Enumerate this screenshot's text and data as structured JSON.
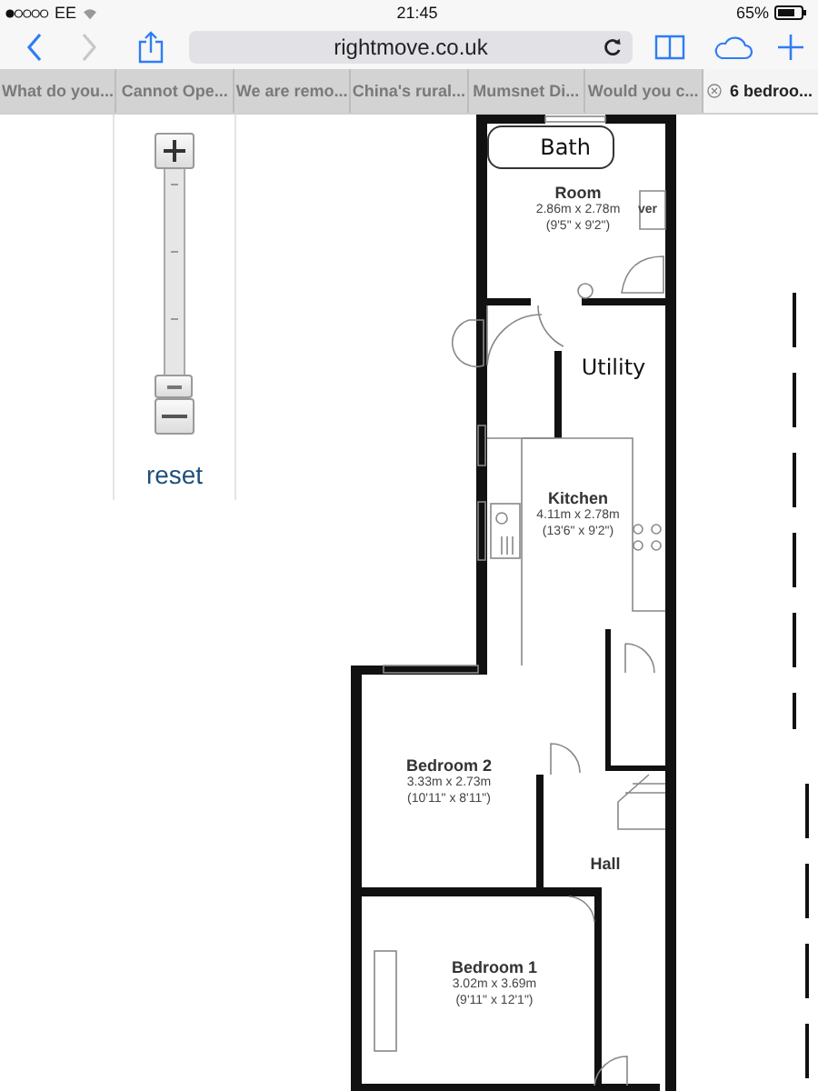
{
  "status_bar": {
    "carrier": "EE",
    "time": "21:45",
    "battery": "65%"
  },
  "toolbar": {
    "url": "rightmove.co.uk",
    "back_disabled": false,
    "forward_disabled": true
  },
  "tabs": [
    {
      "label": "What do you...",
      "selected": false
    },
    {
      "label": "Cannot Ope...",
      "selected": false
    },
    {
      "label": "We are remo...",
      "selected": false
    },
    {
      "label": "China's rural...",
      "selected": false
    },
    {
      "label": "Mumsnet Di...",
      "selected": false
    },
    {
      "label": "Would you c...",
      "selected": false
    },
    {
      "label": "6 bedroo...",
      "selected": true
    }
  ],
  "zoom_control": {
    "level": 0,
    "reset": "reset"
  },
  "floor_plan": {
    "rooms": [
      {
        "name": "Room",
        "size": "2.86m x 2.78m",
        "imperial": "(9'5\" x 9'2\")"
      },
      {
        "name": "Kitchen",
        "size": "4.11m x 2.78m",
        "imperial": "(13'6\" x 9'2\")"
      },
      {
        "name": "Bedroom 2",
        "size": "3.33m x 2.73m",
        "imperial": "(10'11\" x 8'11\")"
      },
      {
        "name": "Hall"
      },
      {
        "name": "Bedroom 1",
        "size": "3.02m x 3.69m",
        "imperial": "(9'11\" x 12'1\")"
      }
    ],
    "fragments": [
      "ver"
    ],
    "annotations": [
      "Bath",
      "Utility"
    ]
  }
}
